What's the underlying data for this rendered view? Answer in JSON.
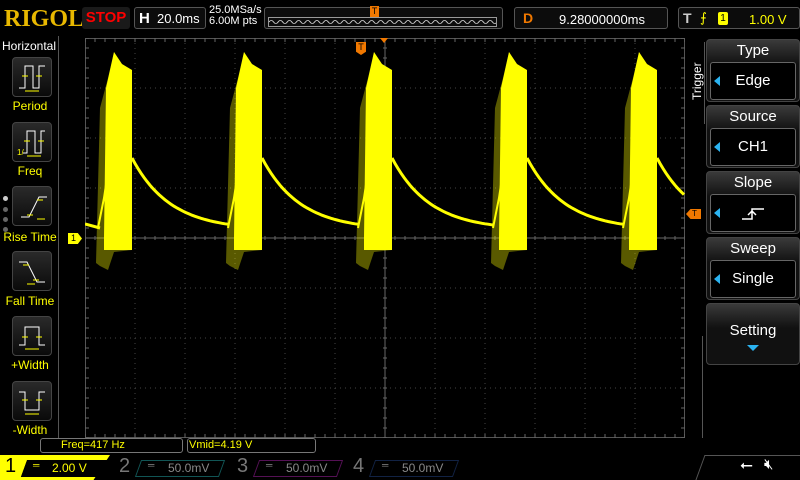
{
  "header": {
    "logo": "RIGOL",
    "run_state": "STOP",
    "horizontal_label": "H",
    "timebase": "20.0ms",
    "sample_rate": "25.0MSa/s",
    "memory_depth": "6.00M pts",
    "trigger_marker": "T",
    "delay_label": "D",
    "delay": "9.28000000ms",
    "trigger_label": "T",
    "trigger_edge": "rising-edge-icon",
    "trigger_source": "1",
    "trigger_level": "1.00 V"
  },
  "left_menu": {
    "title": "Horizontal",
    "items": [
      {
        "label": "Period",
        "icon": "period-icon"
      },
      {
        "label": "Freq",
        "icon": "freq-icon"
      },
      {
        "label": "Rise Time",
        "icon": "rise-time-icon"
      },
      {
        "label": "Fall Time",
        "icon": "fall-time-icon"
      },
      {
        "label": "+Width",
        "icon": "pos-width-icon"
      },
      {
        "label": "-Width",
        "icon": "neg-width-icon"
      }
    ]
  },
  "right_menu": {
    "title": "Trigger",
    "items": [
      {
        "label": "Type",
        "value": "Edge"
      },
      {
        "label": "Source",
        "value": "CH1"
      },
      {
        "label": "Slope",
        "value": "rising-edge-icon"
      },
      {
        "label": "Sweep",
        "value": "Single"
      },
      {
        "label": "Setting"
      }
    ]
  },
  "markers": {
    "ch1": "1",
    "trigger_level": "T"
  },
  "measurements": {
    "freq": "Freq=417 Hz",
    "vmid": "Vmid=4.19 V"
  },
  "channels": [
    {
      "num": "1",
      "scale": "2.00 V",
      "color": "#ffff00"
    },
    {
      "num": "2",
      "scale": "50.0mV",
      "color": "#00a0a0"
    },
    {
      "num": "3",
      "scale": "50.0mV",
      "color": "#c000c0"
    },
    {
      "num": "4",
      "scale": "50.0mV",
      "color": "#2060d0"
    }
  ],
  "status": {
    "usb": "usb-icon",
    "sound": "mute-icon"
  },
  "colors": {
    "ch1": "#ffff00",
    "trigger": "#f07800",
    "accent": "#2bb3f0"
  }
}
